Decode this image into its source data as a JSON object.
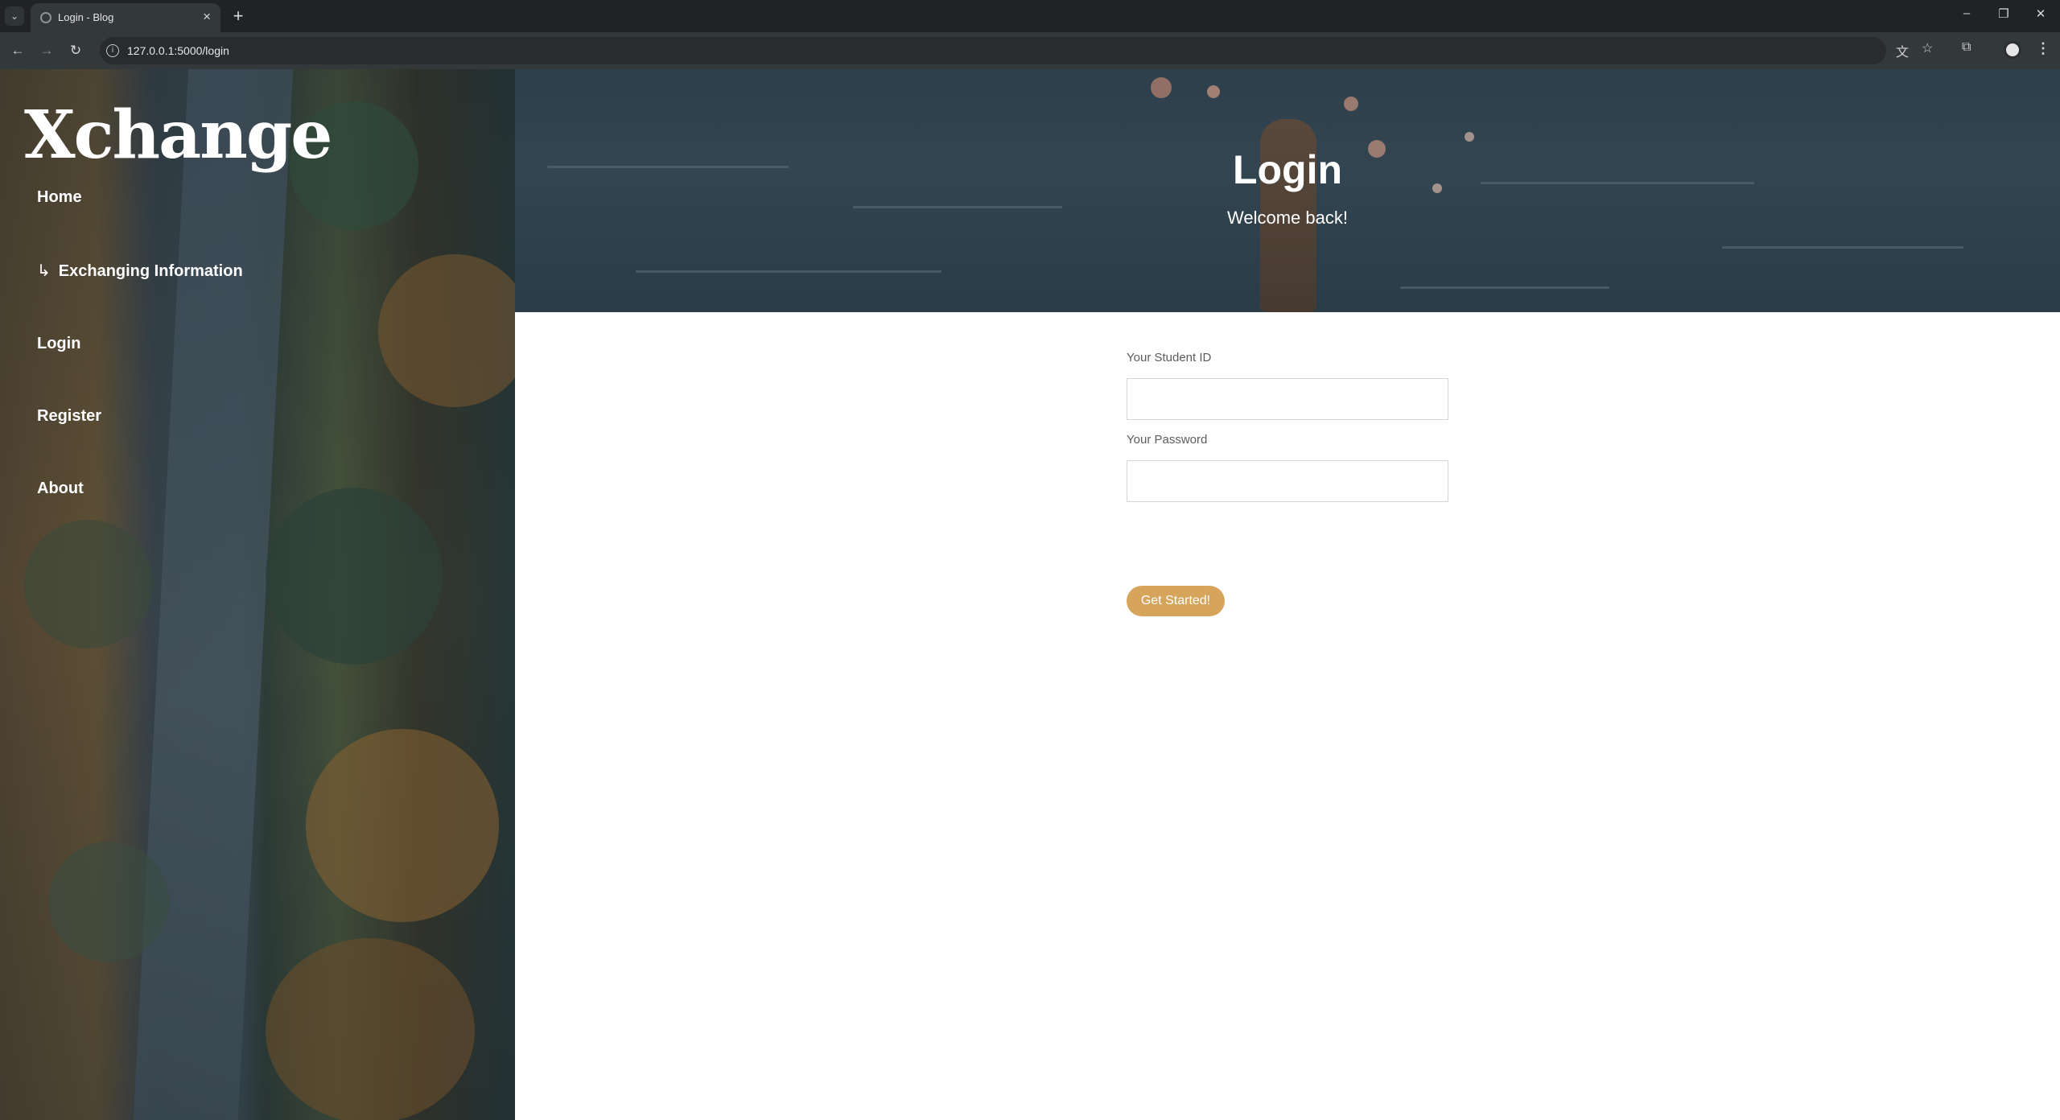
{
  "browser": {
    "tab_title": "Login - Blog",
    "url": "127.0.0.1:5000/login",
    "icons": {
      "tab_search": "chevron-down-icon",
      "close_tab": "close-icon",
      "new_tab": "plus-icon",
      "back": "arrow-left-icon",
      "forward": "arrow-right-icon",
      "reload": "reload-icon",
      "site_info": "info-icon",
      "translate": "translate-icon",
      "bookmark": "star-icon",
      "extensions": "puzzle-icon",
      "profile": "avatar",
      "menu": "kebab-menu-icon"
    }
  },
  "sidebar": {
    "brand": "Xchange",
    "nav": [
      {
        "label": "Home"
      },
      {
        "label": "Exchanging Information",
        "prefix": "↳"
      },
      {
        "label": "Login"
      },
      {
        "label": "Register"
      },
      {
        "label": "About"
      }
    ]
  },
  "hero": {
    "title": "Login",
    "subtitle": "Welcome back!"
  },
  "form": {
    "student_id_label": "Your Student ID",
    "student_id_value": "",
    "password_label": "Your Password",
    "password_value": "",
    "submit_label": "Get Started!"
  },
  "colors": {
    "accent": "#d6a55b",
    "chrome_dark": "#1f2326",
    "chrome_toolbar": "#33383b"
  }
}
